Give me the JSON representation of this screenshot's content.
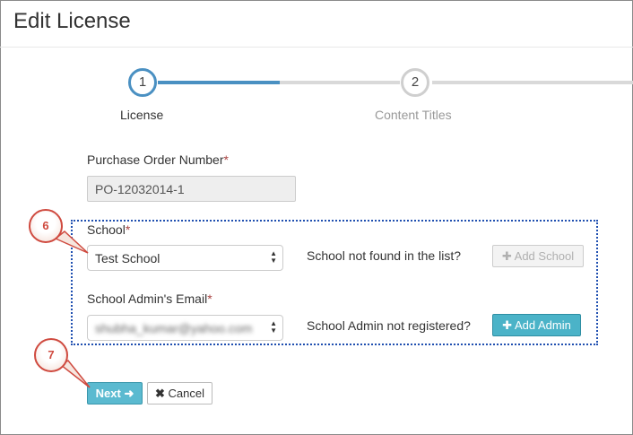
{
  "page": {
    "title": "Edit License"
  },
  "stepper": {
    "steps": [
      {
        "number": "1",
        "label": "License",
        "state": "active"
      },
      {
        "number": "2",
        "label": "Content Titles",
        "state": "inactive"
      }
    ]
  },
  "form": {
    "po_label": "Purchase Order Number",
    "po_value": "PO-12032014-1",
    "required_mark": "*",
    "school_label": "School",
    "school_value": "Test School",
    "school_not_found": "School not found in the list?",
    "add_school_label": "Add School",
    "admin_label": "School Admin's Email",
    "admin_value": "shubha_kumar@yahoo.com",
    "admin_not_registered": "School Admin not registered?",
    "add_admin_label": "Add Admin",
    "next_label": "Next",
    "cancel_label": "Cancel"
  },
  "callouts": [
    "6",
    "7"
  ],
  "colors": {
    "accent": "#4a90c2",
    "button_teal": "#5bbad0",
    "callout_red": "#cf4a3f",
    "annotation_blue": "#1f4fb0"
  }
}
